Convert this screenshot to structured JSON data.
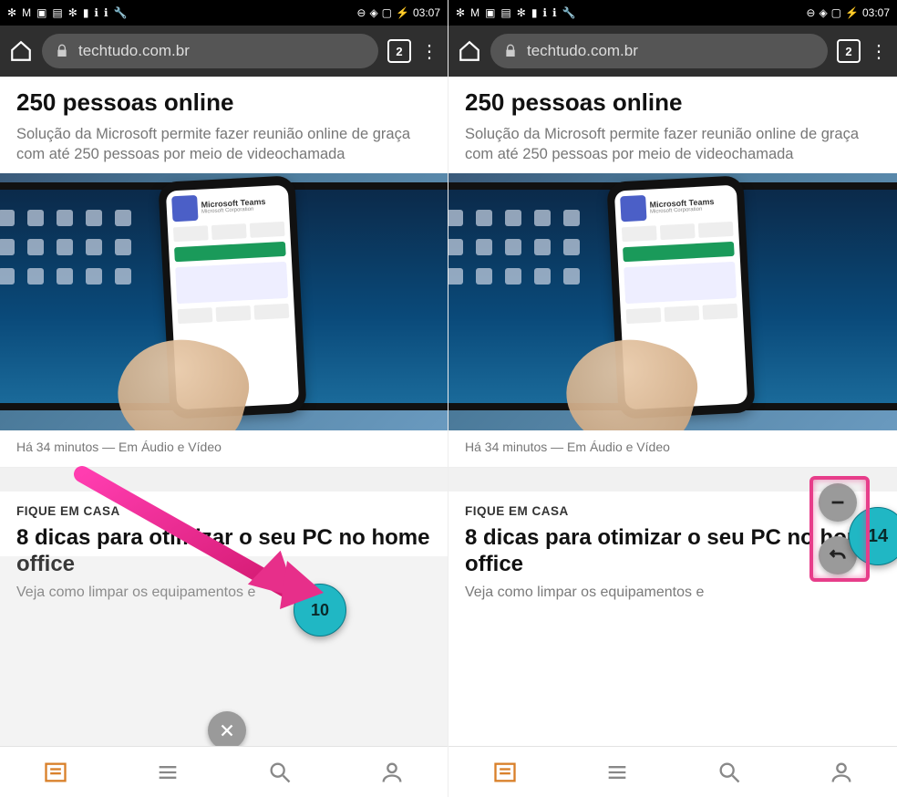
{
  "statusbar": {
    "time": "03:07"
  },
  "browser": {
    "url": "techtudo.com.br",
    "tab_count": "2"
  },
  "article1": {
    "headline_partial": "250 pessoas online",
    "subtitle": "Solução da Microsoft permite fazer reunião online de graça com até 250 pessoas por meio de videochamada",
    "meta": "Há 34 minutos — Em Áudio e Vídeo",
    "photo_app_name": "Microsoft Teams",
    "photo_app_sub": "Microsoft Corporation"
  },
  "article2": {
    "kicker": "FIQUE EM CASA",
    "headline": "8 dicas para otimizar o seu PC no home office",
    "subtitle_left": "Veja como limpar os equipamentos e",
    "subtitle_right": "Veja como limpar os equipamentos e"
  },
  "left_pane": {
    "bubble_value": "10"
  },
  "right_pane": {
    "bubble_value": "14"
  }
}
